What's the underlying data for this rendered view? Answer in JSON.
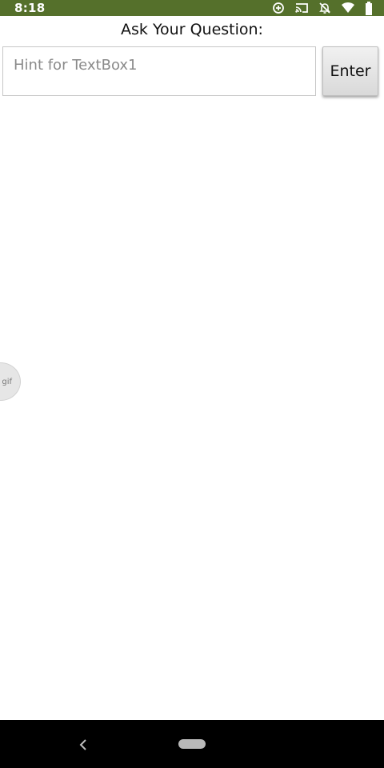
{
  "status_bar": {
    "time": "8:18",
    "icons": [
      "data-saver-icon",
      "cast-icon",
      "notifications-off-icon",
      "wifi-icon",
      "battery-icon"
    ],
    "background": "#55702b"
  },
  "main": {
    "question_label": "Ask Your Question:",
    "textbox": {
      "placeholder": "Hint for TextBox1",
      "value": ""
    },
    "enter_button_label": "Enter"
  },
  "overlay": {
    "gif_badge": "gif"
  },
  "nav_bar": {
    "icons": [
      "back-icon",
      "home-icon"
    ]
  }
}
